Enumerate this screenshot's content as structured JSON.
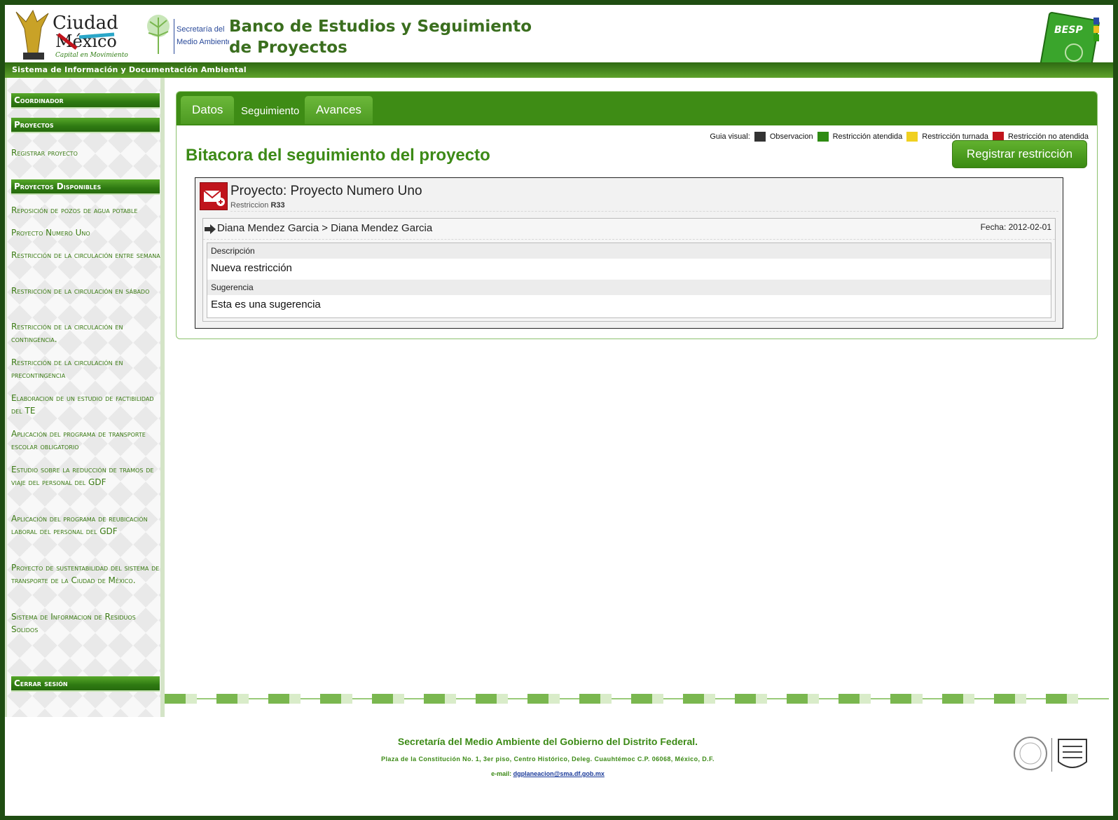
{
  "header": {
    "logo_line1": "Ciudad",
    "logo_line2": "México",
    "logo_tagline": "Capital en Movimiento",
    "sma_line1": "Secretaría del",
    "sma_line2": "Medio Ambiente",
    "title": "Banco de Estudios y Seguimiento de Proyectos",
    "besp": "BESP",
    "subtitle": "Sistema de Información y Documentación Ambiental"
  },
  "sidebar": {
    "coordinador": "Coordinador",
    "proyectos": "Proyectos",
    "registrar": "Registrar proyecto",
    "disponibles": "Proyectos Disponibles",
    "items": [
      "Reposición de pozos de agua potable",
      "Proyecto Numero Uno",
      "Restricción de la circulación entre semana",
      "Restricción de la circulación en sábado",
      "Restricción de la circulación en contingencia.",
      "Restricción de la circulación en precontingencia",
      "Elaboracion de un estudio de factibilidad del TE",
      "Aplicación del programa de transporte escolar obligatorio",
      "Estudio sobre la reducción de tramos de viaje del personal del GDF",
      "Aplicación del programa de reubicación laboral del personal del GDF",
      "Proyecto de sustentabilidad del sistema de transporte de la Ciudad de México.",
      "Sistema de Informacion de Residuos Solidos"
    ],
    "cerrar": "Cerrar sesión"
  },
  "tabs": {
    "datos": "Datos",
    "seguimiento": "Seguimiento",
    "avances": "Avances"
  },
  "legend": {
    "label": "Guia visual:",
    "items": [
      {
        "text": "Observacion",
        "color": "#333333"
      },
      {
        "text": "Restricción atendida",
        "color": "#2e8b12"
      },
      {
        "text": "Restricción turnada",
        "color": "#f0d020"
      },
      {
        "text": "Restricción no atendida",
        "color": "#c0141c"
      }
    ]
  },
  "main": {
    "title": "Bitacora del seguimiento del proyecto",
    "register_button": "Registrar restricción"
  },
  "card": {
    "title": "Proyecto: Proyecto Numero Uno",
    "sub_label": "Restriccion",
    "sub_code": "R33",
    "entry_who": "Diana Mendez Garcia > Diana Mendez Garcia",
    "entry_date": "Fecha: 2012-02-01",
    "desc_label": "Descripción",
    "desc_value": "Nueva restricción",
    "sug_label": "Sugerencia",
    "sug_value": "Esta es una sugerencia"
  },
  "footer": {
    "line1": "Secretaría del Medio Ambiente del Gobierno del Distrito Federal.",
    "line2": "Plaza de la Constitución No. 1, 3er piso, Centro Histórico, Deleg. Cuauhtémoc C.P. 06068, México, D.F.",
    "email_label": "e-mail:",
    "email": "dgplaneacion@sma.df.gob.mx"
  }
}
